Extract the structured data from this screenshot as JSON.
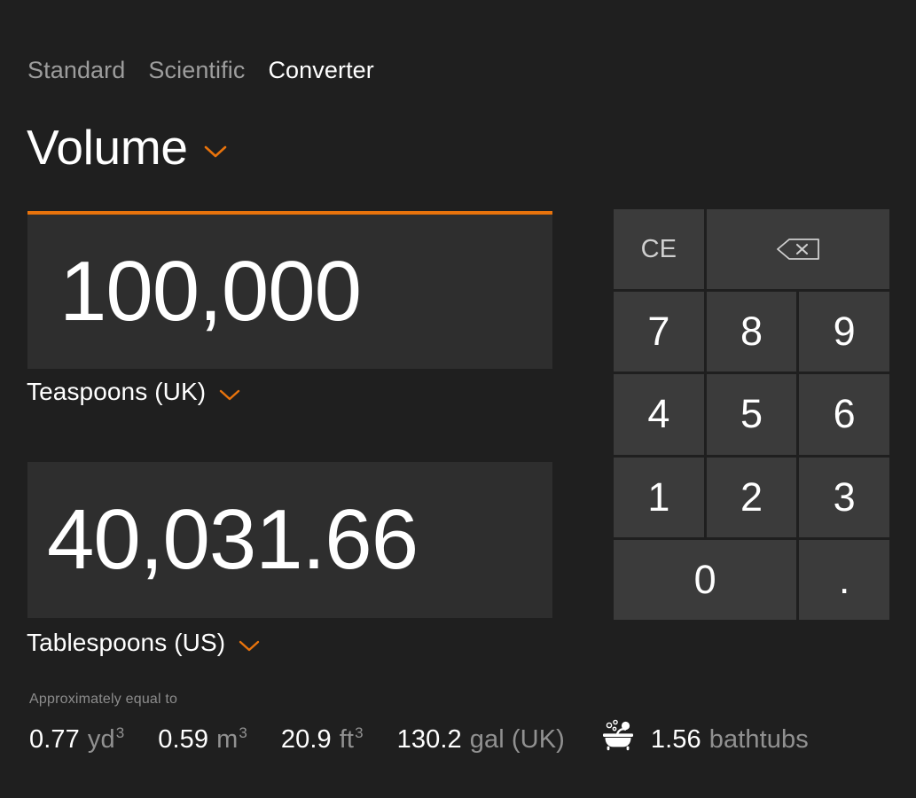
{
  "tabs": [
    {
      "label": "Standard",
      "active": false
    },
    {
      "label": "Scientific",
      "active": false
    },
    {
      "label": "Converter",
      "active": true
    }
  ],
  "category": {
    "name": "Volume",
    "chevron_icon": "chevron-down-icon"
  },
  "accent_color": "#e8730c",
  "converter": {
    "input": {
      "value": "100,000",
      "unit": "Teaspoons (UK)",
      "chevron_icon": "chevron-down-icon",
      "focused": true
    },
    "output": {
      "value": "40,031.66",
      "unit": "Tablespoons (US)",
      "chevron_icon": "chevron-down-icon",
      "focused": false
    }
  },
  "supplementary": {
    "title": "Approximately equal to",
    "items": [
      {
        "value": "0.77",
        "unit": "yd",
        "exponent": "3",
        "icon": null
      },
      {
        "value": "0.59",
        "unit": "m",
        "exponent": "3",
        "icon": null
      },
      {
        "value": "20.9",
        "unit": "ft",
        "exponent": "3",
        "icon": null
      },
      {
        "value": "130.2",
        "unit": "gal (UK)",
        "exponent": "",
        "icon": null
      },
      {
        "value": "1.56",
        "unit": "bathtubs",
        "exponent": "",
        "icon": "bathtub-icon"
      }
    ]
  },
  "keypad": {
    "clear_entry": "CE",
    "backspace_icon": "backspace-icon",
    "keys": [
      "7",
      "8",
      "9",
      "4",
      "5",
      "6",
      "1",
      "2",
      "3"
    ],
    "zero": "0",
    "decimal": "."
  }
}
